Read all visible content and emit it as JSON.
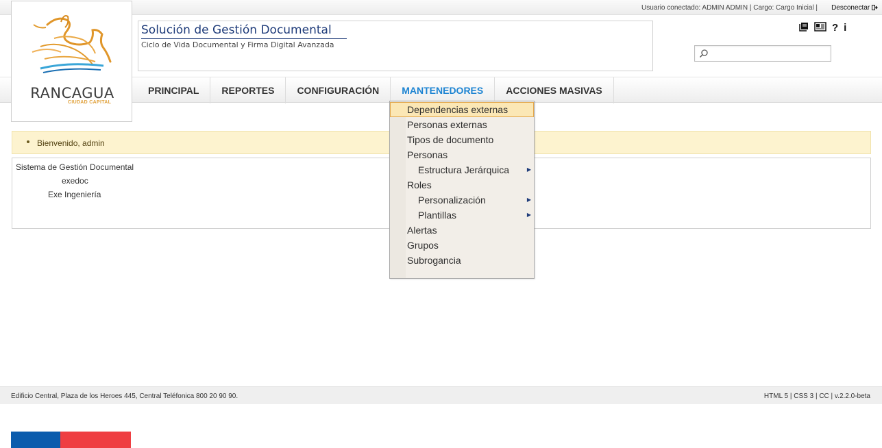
{
  "userbar": {
    "info": "Usuario conectado: ADMIN ADMIN | Cargo: Cargo Inicial |",
    "logout": "Desconectar"
  },
  "logo": {
    "title": "RANCAGUA",
    "subtitle": "CIUDAD CAPITAL"
  },
  "header": {
    "title": "Solución de Gestión Documental",
    "subtitle": "Ciclo de Vida Documental y Firma Digital Avanzada"
  },
  "tools": {
    "help": "?",
    "info": "i"
  },
  "search": {
    "value": "",
    "placeholder": ""
  },
  "nav": {
    "items": [
      "PRINCIPAL",
      "REPORTES",
      "CONFIGURACIÓN",
      "MANTENEDORES",
      "ACCIONES MASIVAS"
    ]
  },
  "dropdown": {
    "items": [
      "Dependencias externas",
      "Personas externas",
      "Tipos de documento",
      "Personas",
      "Estructura Jerárquica",
      "Roles",
      "Personalización",
      "Plantillas",
      "Alertas",
      "Grupos",
      "Subrogancia"
    ],
    "highlighted": "Dependencias externas"
  },
  "message": {
    "text": "Bienvenido, admin"
  },
  "panel": {
    "line1": "Sistema de Gestión Documental",
    "line2": "exedoc",
    "line3": "Exe Ingeniería"
  },
  "footer": {
    "address": "Edificio Central, Plaza de los Heroes 445, Central Teléfonica 800 20 90 90.",
    "version": "HTML 5 | CSS 3 | CC | v.2.2.0-beta"
  },
  "colors": {
    "accent": "#1d84d2",
    "title_blue": "#1f3c7a",
    "flag_blue": "#0b5cad",
    "flag_red": "#ef3e42",
    "message_bg": "#fdf3cf",
    "highlight": "#fbe7b5"
  }
}
